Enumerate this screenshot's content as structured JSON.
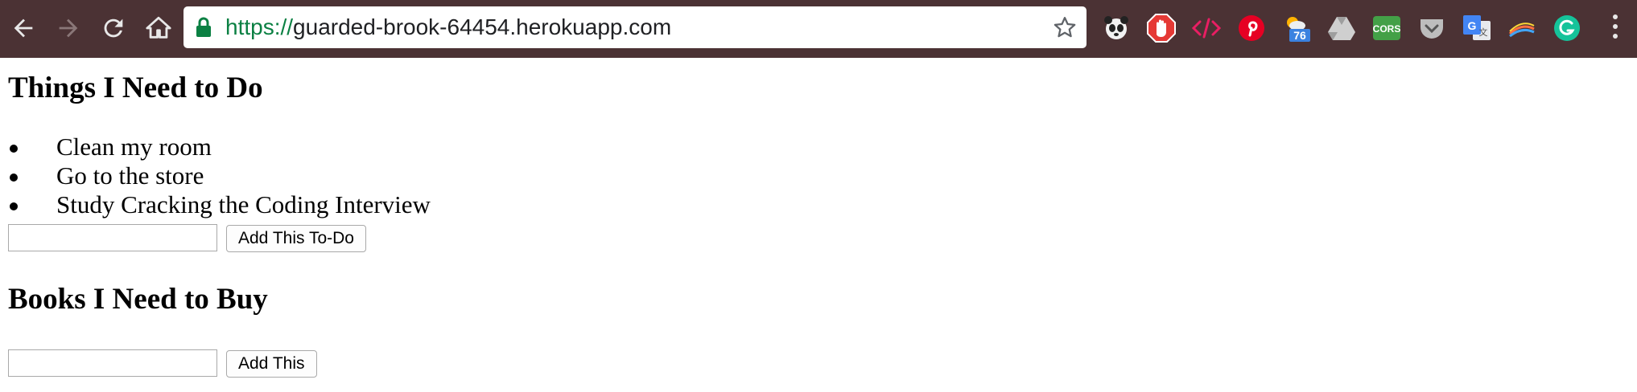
{
  "browser": {
    "url_scheme": "https://",
    "url_host": "guarded-brook-64454.herokuapp.com",
    "extensions": [
      {
        "name": "panda-icon",
        "color": "#222222"
      },
      {
        "name": "adblock-icon",
        "color": "#e53935"
      },
      {
        "name": "code-icon",
        "color": "#e91e63"
      },
      {
        "name": "pinterest-icon",
        "color": "#e60023"
      },
      {
        "name": "weather-icon",
        "color": "#4a90e2",
        "badge": "76"
      },
      {
        "name": "drive-icon",
        "color": "#cfcfcf"
      },
      {
        "name": "cors-icon",
        "color": "#4caf50",
        "label": "CORS"
      },
      {
        "name": "pocket-icon",
        "color": "#bdbdbd"
      },
      {
        "name": "translate-icon",
        "color": "#4285f4"
      },
      {
        "name": "rainbow-icon",
        "color": "#ff7043"
      },
      {
        "name": "grammarly-icon",
        "color": "#15c39a"
      }
    ]
  },
  "page": {
    "todo_heading": "Things I Need to Do",
    "todos": [
      "Clean my room",
      "Go to the store",
      "Study Cracking the Coding Interview"
    ],
    "todo_input_value": "",
    "todo_button_label": "Add This To-Do",
    "books_heading": "Books I Need to Buy",
    "book_input_value": "",
    "book_button_label": "Add This"
  }
}
